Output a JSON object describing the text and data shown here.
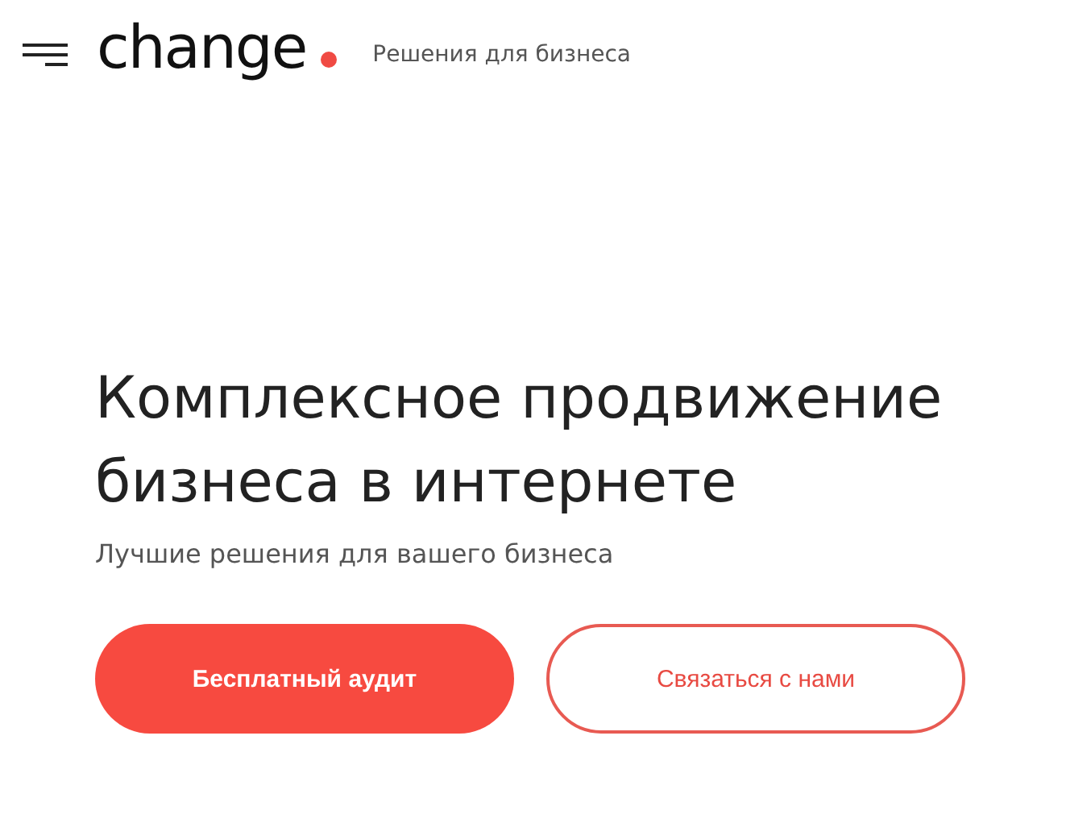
{
  "header": {
    "logo": "change",
    "tagline": "Решения для бизнеса"
  },
  "hero": {
    "title": "Комплексное продвижение бизнеса в интернете",
    "subtitle": "Лучшие решения для вашего бизнеса",
    "buttons": [
      {
        "label": "Бесплатный аудит",
        "kind": "primary"
      },
      {
        "label": "Связаться с нами",
        "kind": "outline"
      }
    ]
  }
}
